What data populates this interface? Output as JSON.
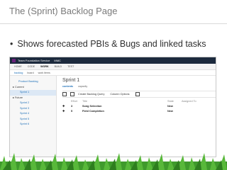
{
  "slide": {
    "title": "The (Sprint) Backlog Page",
    "bullet": "Shows forecasted PBIs & Bugs and linked tasks"
  },
  "screenshot": {
    "topbar": {
      "service": "Team Foundation Service",
      "project": "MMC"
    },
    "nav": [
      "HOME",
      "CODE",
      "WORK",
      "BUILD",
      "TEST"
    ],
    "subnav": [
      "backlog",
      "board",
      "work items"
    ],
    "sidebar": {
      "product_backlog": "Product Backlog",
      "current_label": "Current",
      "current_sprint": "Sprint 1",
      "future_label": "Future",
      "future_sprints": [
        "Sprint 2",
        "Sprint 3",
        "Sprint 4",
        "Sprint 5",
        "Sprint 6"
      ]
    },
    "main": {
      "heading": "Sprint 1",
      "tabs": [
        "contents",
        "capacity"
      ],
      "toolbar": {
        "create_query": "Create Backlog Query",
        "column_options": "Column Options"
      },
      "columns": [
        "",
        "Effort",
        "Title",
        "State",
        "Assigned To"
      ],
      "rows": [
        {
          "effort": "3",
          "title": "Song Selection",
          "state": "New"
        },
        {
          "effort": "5",
          "title": "Field Completion",
          "state": "New"
        }
      ]
    }
  },
  "colors": {
    "topbar": "#1c2a3d",
    "accent": "#2272b9",
    "grass": "#3f9a2c"
  }
}
